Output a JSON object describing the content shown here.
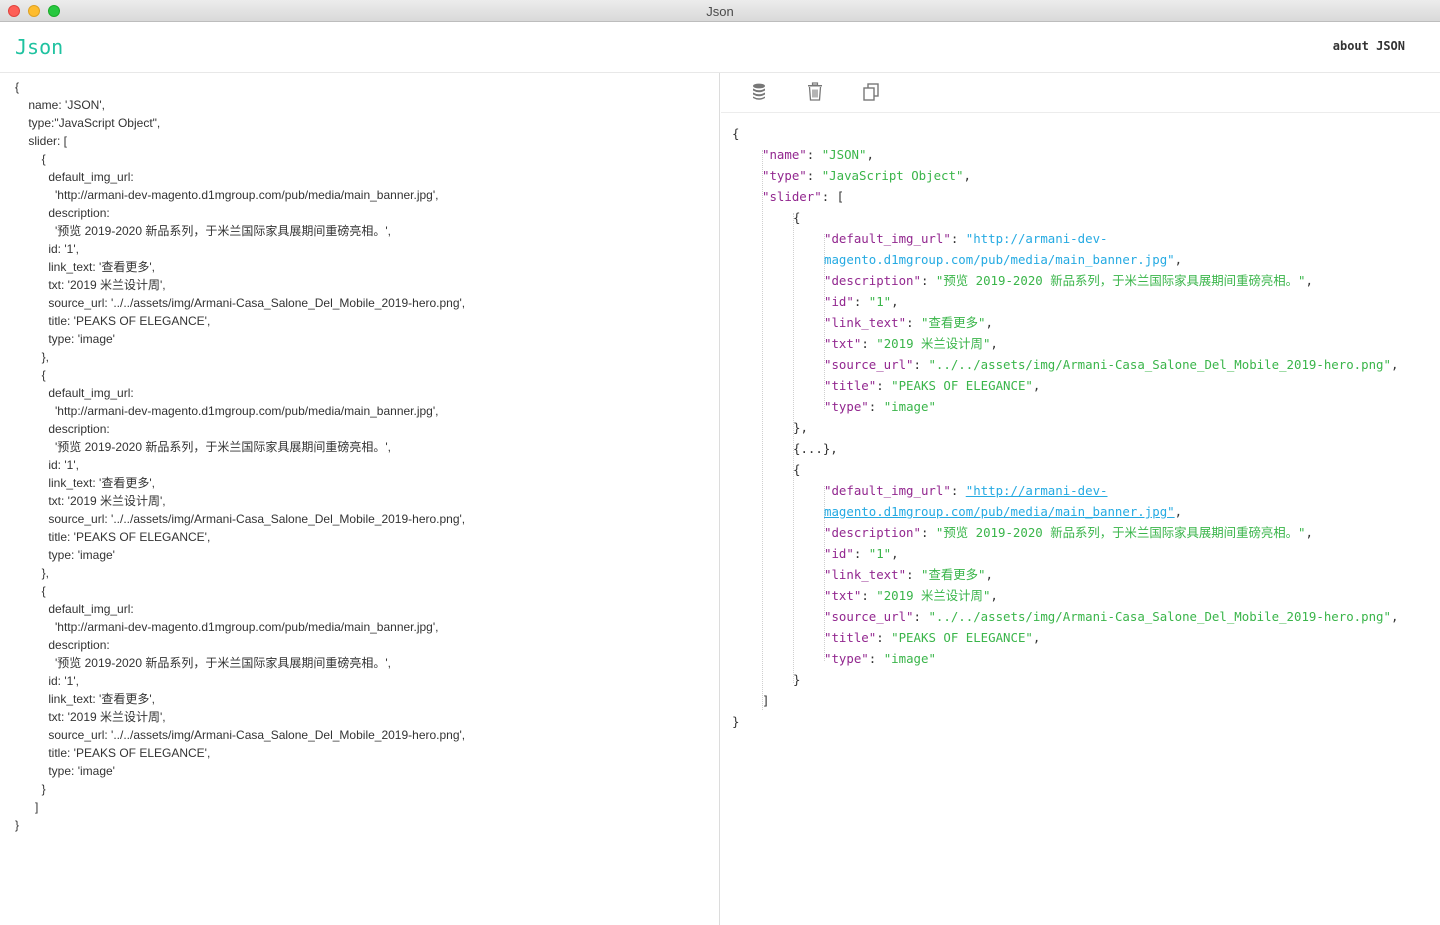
{
  "window": {
    "title": "Json"
  },
  "header": {
    "logo": "Json",
    "about_label": "about JSON"
  },
  "toolbar": {
    "icons": [
      "database-icon",
      "trash-icon",
      "copy-icon"
    ]
  },
  "editor": {
    "lines": [
      "{",
      "    name: 'JSON',",
      "    type:\"JavaScript Object\",",
      "    slider: [",
      "        {",
      "          default_img_url:",
      "            'http://armani-dev-magento.d1mgroup.com/pub/media/main_banner.jpg',",
      "          description:",
      "            '预览 2019-2020 新品系列，于米兰国际家具展期间重磅亮相。',",
      "          id: '1',",
      "          link_text: '查看更多',",
      "          txt: '2019 米兰设计周',",
      "          source_url: '../../assets/img/Armani-Casa_Salone_Del_Mobile_2019-hero.png',",
      "          title: 'PEAKS OF ELEGANCE',",
      "          type: 'image'",
      "        },",
      "        {",
      "          default_img_url:",
      "            'http://armani-dev-magento.d1mgroup.com/pub/media/main_banner.jpg',",
      "          description:",
      "            '预览 2019-2020 新品系列，于米兰国际家具展期间重磅亮相。',",
      "          id: '1',",
      "          link_text: '查看更多',",
      "          txt: '2019 米兰设计周',",
      "          source_url: '../../assets/img/Armani-Casa_Salone_Del_Mobile_2019-hero.png',",
      "          title: 'PEAKS OF ELEGANCE',",
      "          type: 'image'",
      "        },",
      "        {",
      "          default_img_url:",
      "            'http://armani-dev-magento.d1mgroup.com/pub/media/main_banner.jpg',",
      "          description:",
      "            '预览 2019-2020 新品系列，于米兰国际家具展期间重磅亮相。',",
      "          id: '1',",
      "          link_text: '查看更多',",
      "          txt: '2019 米兰设计周',",
      "          source_url: '../../assets/img/Armani-Casa_Salone_Del_Mobile_2019-hero.png',",
      "          title: 'PEAKS OF ELEGANCE',",
      "          type: 'image'",
      "        }",
      "      ]",
      "}"
    ]
  },
  "viewer": {
    "open_brace": "{",
    "close_brace": "}",
    "name_key": "\"name\"",
    "name_val": "\"JSON\"",
    "type_key": "\"type\"",
    "type_val": "\"JavaScript Object\"",
    "slider_key": "\"slider\"",
    "slider_open": "[",
    "slider_close": "]",
    "collapsed_item": "{...},",
    "item_open": "{",
    "item_close_comma": "},",
    "item_close": "}",
    "items": [
      {
        "default_img_url_key": "\"default_img_url\"",
        "default_img_url_val_1": "\"http://armani-dev-",
        "default_img_url_val_2": "magento.d1mgroup.com/pub/media/main_banner.jpg\"",
        "description_key": "\"description\"",
        "description_val": "\"预览 2019-2020 新品系列，于米兰国际家具展期间重磅亮相。\"",
        "id_key": "\"id\"",
        "id_val": "\"1\"",
        "link_text_key": "\"link_text\"",
        "link_text_val": "\"查看更多\"",
        "txt_key": "\"txt\"",
        "txt_val": "\"2019 米兰设计周\"",
        "source_url_key": "\"source_url\"",
        "source_url_val": "\"../../assets/img/Armani-Casa_Salone_Del_Mobile_2019-hero.png\"",
        "title_key": "\"title\"",
        "title_val": "\"PEAKS OF ELEGANCE\"",
        "type_key": "\"type\"",
        "type_val": "\"image\""
      },
      {
        "default_img_url_key": "\"default_img_url\"",
        "default_img_url_val_1": "\"http://armani-dev-",
        "default_img_url_val_2": "magento.d1mgroup.com/pub/media/main_banner.jpg\"",
        "description_key": "\"description\"",
        "description_val": "\"预览 2019-2020 新品系列，于米兰国际家具展期间重磅亮相。\"",
        "id_key": "\"id\"",
        "id_val": "\"1\"",
        "link_text_key": "\"link_text\"",
        "link_text_val": "\"查看更多\"",
        "txt_key": "\"txt\"",
        "txt_val": "\"2019 米兰设计周\"",
        "source_url_key": "\"source_url\"",
        "source_url_val": "\"../../assets/img/Armani-Casa_Salone_Del_Mobile_2019-hero.png\"",
        "title_key": "\"title\"",
        "title_val": "\"PEAKS OF ELEGANCE\"",
        "type_key": "\"type\"",
        "type_val": "\"image\""
      }
    ]
  },
  "colors": {
    "brand": "#1fc2a0",
    "key": "#92278f",
    "string": "#3ab54a",
    "url": "#25aae2"
  }
}
